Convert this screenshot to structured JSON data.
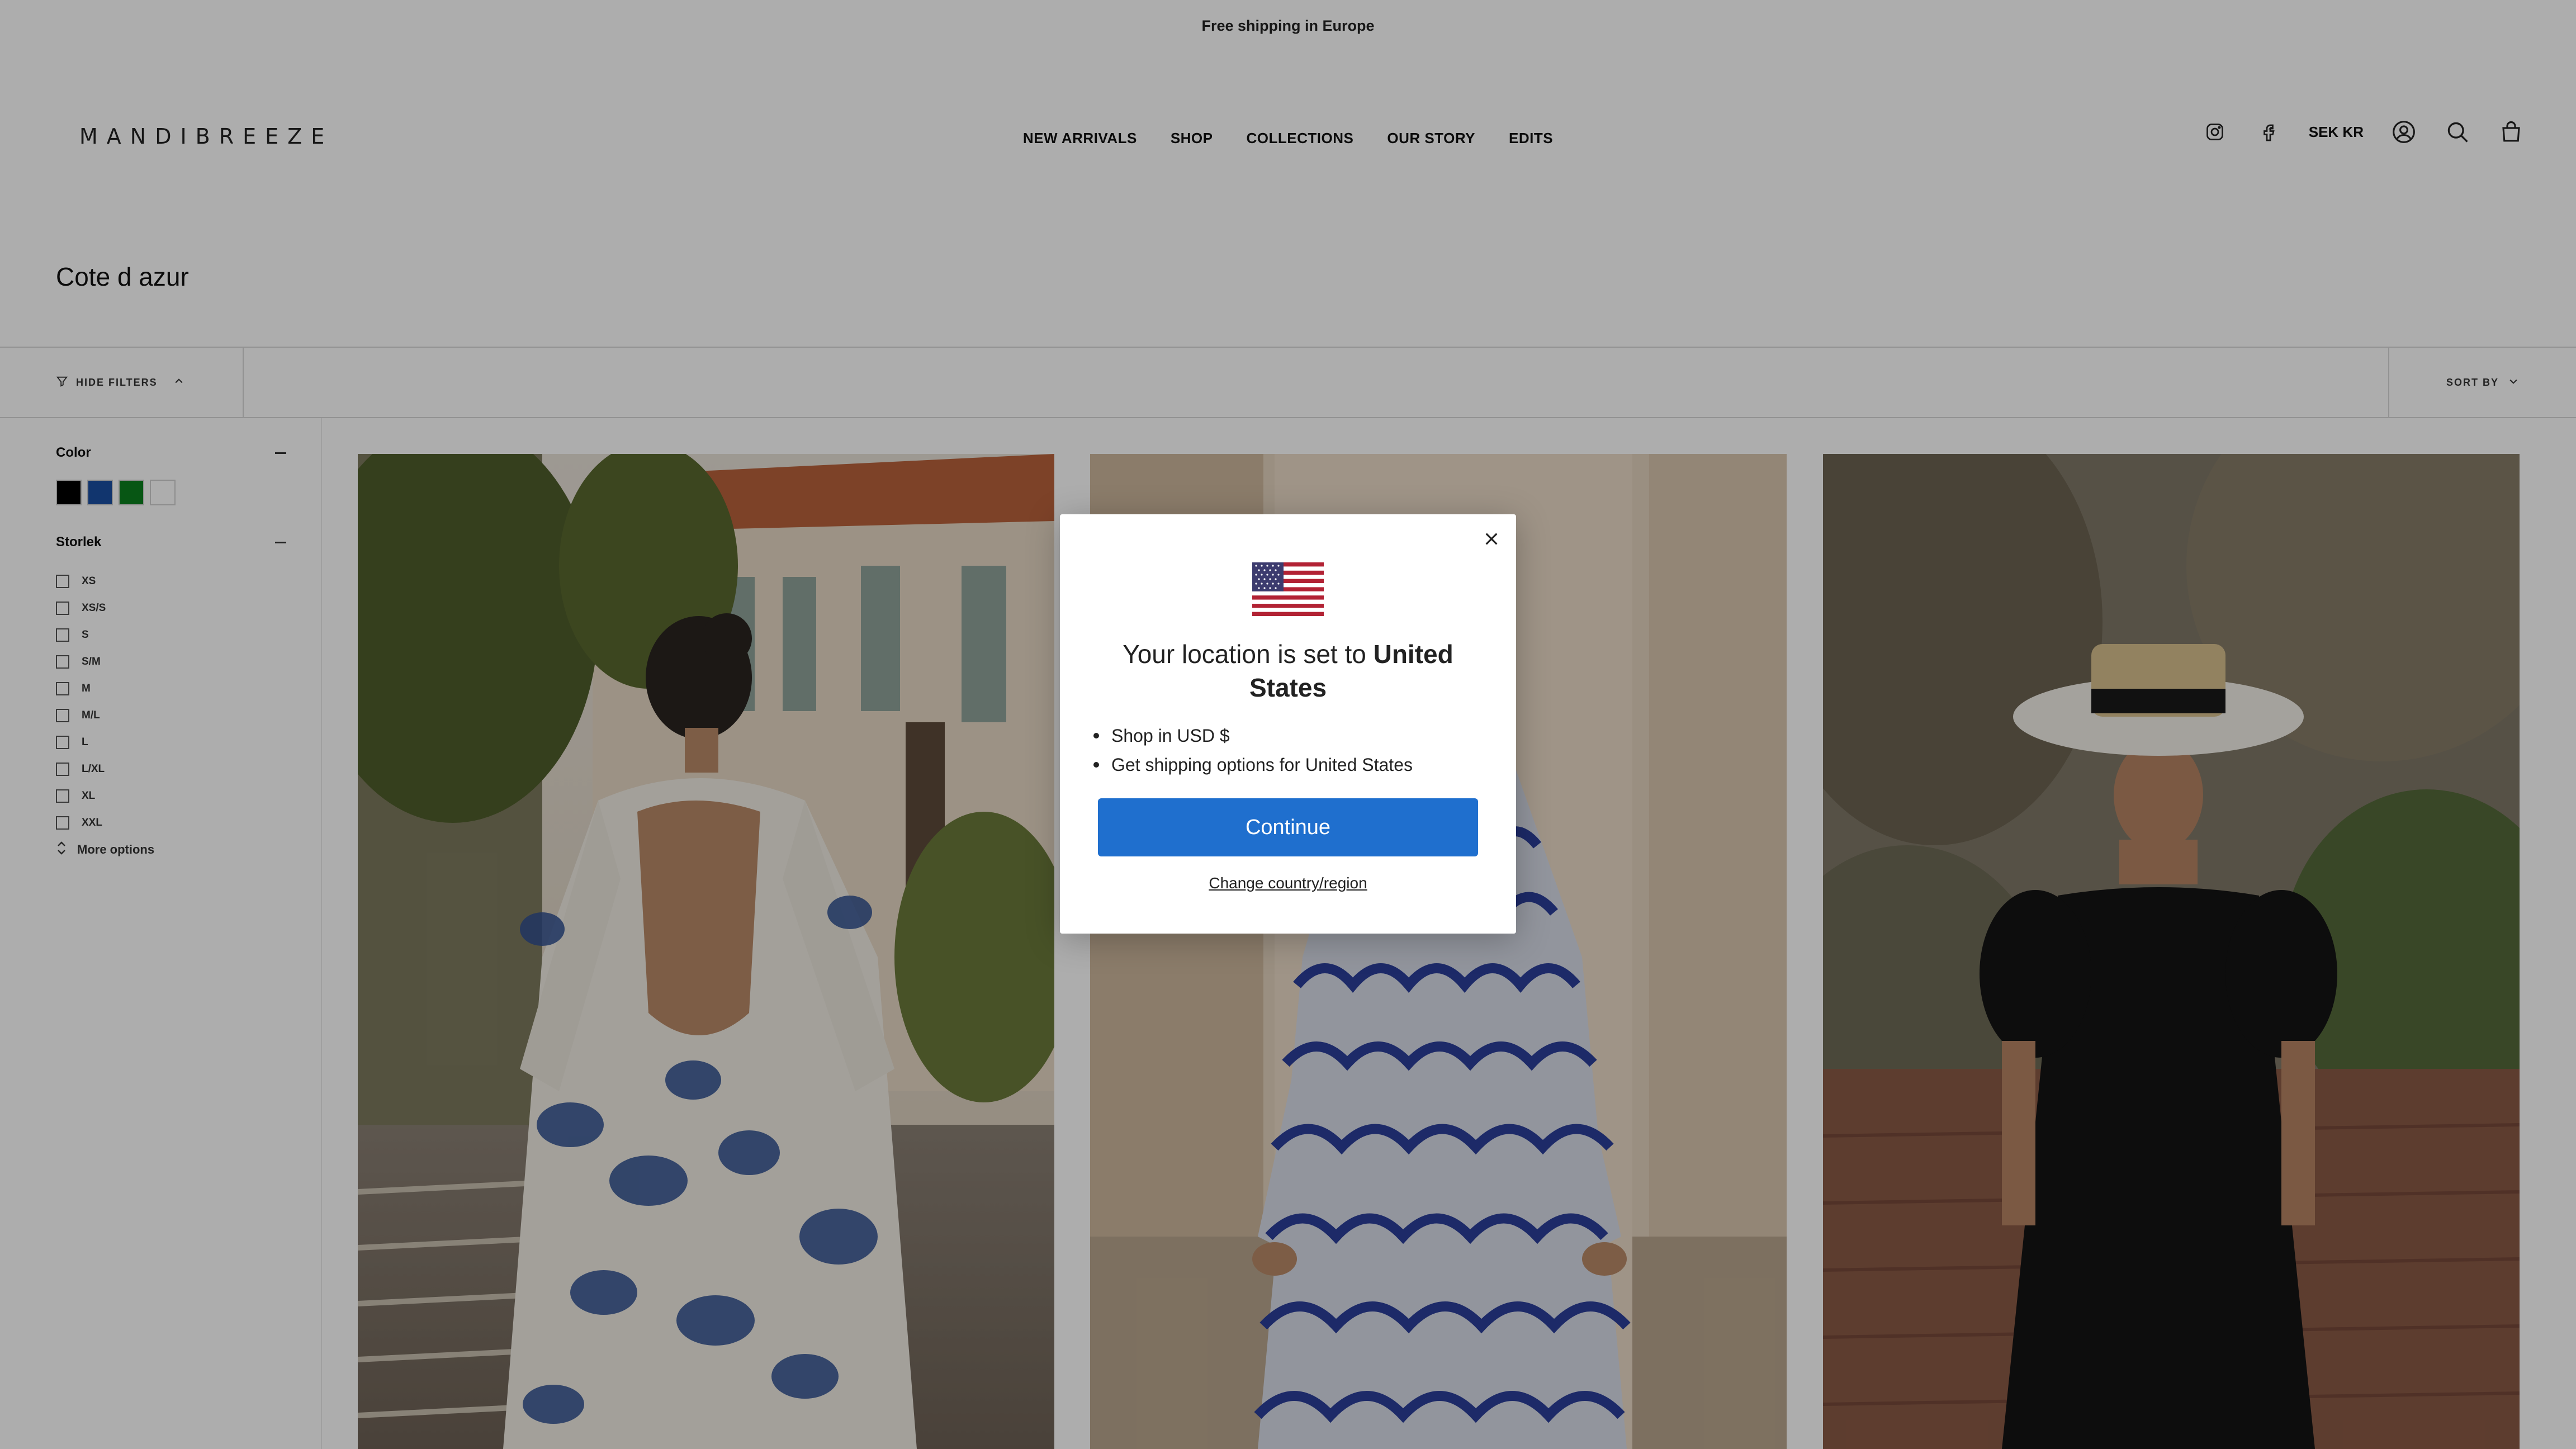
{
  "announcement": "Free shipping in Europe",
  "header": {
    "logo": "MANDIBREEZE",
    "nav": [
      "NEW ARRIVALS",
      "SHOP",
      "COLLECTIONS",
      "OUR STORY",
      "EDITS"
    ],
    "currency": "SEK KR",
    "icons": [
      "instagram-icon",
      "facebook-icon",
      "account-icon",
      "search-icon",
      "cart-icon"
    ]
  },
  "page_title": "Cote d azur",
  "filterbar": {
    "hide_filters": "HIDE FILTERS",
    "sort_by": "SORT BY"
  },
  "sidebar": {
    "color_title": "Color",
    "colors": [
      "#000000",
      "#1a4fa3",
      "#0b7f1e",
      "#ffffff"
    ],
    "size_title": "Storlek",
    "sizes": [
      "XS",
      "XS/S",
      "S",
      "S/M",
      "M",
      "M/L",
      "L",
      "L/XL",
      "XL",
      "XXL"
    ],
    "more_options": "More options"
  },
  "modal": {
    "title_prefix": "Your location is set to",
    "country": "United States",
    "bullets": [
      "Shop in USD $",
      "Get shipping options for United States"
    ],
    "continue": "Continue",
    "change": "Change country/region"
  }
}
